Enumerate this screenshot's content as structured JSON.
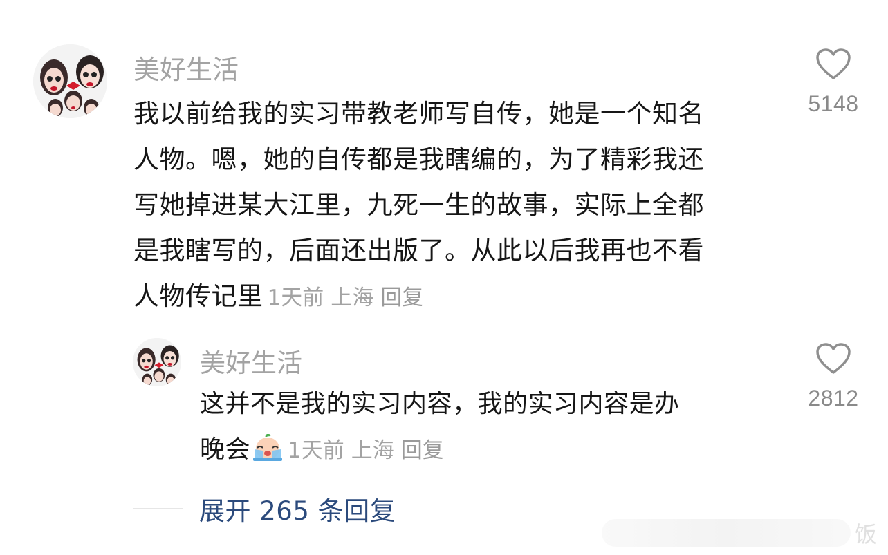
{
  "comments": [
    {
      "username": "美好生活",
      "lines": [
        "我以前给我的实习带教老师写自传，她是一个知名",
        "人物。嗯，她的自传都是我瞎编的，为了精彩我还",
        "写她掉进某大江里，九死一生的故事，实际上全都",
        "是我瞎写的，后面还出版了。从此以后我再也不看",
        "人物传记里"
      ],
      "time": "1天前",
      "location": "上海",
      "reply_label": "回复",
      "likes": "5148",
      "like_icon": "heart-outline-icon"
    },
    {
      "username": "美好生活",
      "lines": [
        "这并不是我的实习内容，我的实习内容是办",
        "晚会"
      ],
      "emoji": "crying-face-emoji",
      "time": "1天前",
      "location": "上海",
      "reply_label": "回复",
      "likes": "2812",
      "like_icon": "heart-outline-icon"
    }
  ],
  "expand_replies": "展开 265 条回复",
  "watermark_text": "饭",
  "colors": {
    "username": "#a3a3a3",
    "body_text": "#161616",
    "meta": "#a3a3a3",
    "expand_link": "#2b4a7c"
  }
}
